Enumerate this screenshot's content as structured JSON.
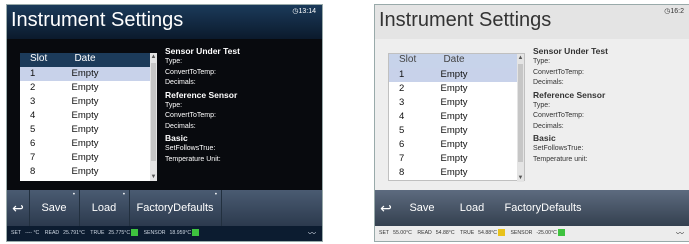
{
  "screens": {
    "dark": {
      "title": "Instrument Settings",
      "clock": "13:14",
      "list_header": {
        "slot": "Slot",
        "date": "Date"
      },
      "rows": [
        {
          "slot": "1",
          "date": "Empty"
        },
        {
          "slot": "2",
          "date": "Empty"
        },
        {
          "slot": "3",
          "date": "Empty"
        },
        {
          "slot": "4",
          "date": "Empty"
        },
        {
          "slot": "5",
          "date": "Empty"
        },
        {
          "slot": "6",
          "date": "Empty"
        },
        {
          "slot": "7",
          "date": "Empty"
        },
        {
          "slot": "8",
          "date": "Empty"
        }
      ],
      "info": {
        "sut_heading": "Sensor Under Test",
        "sut_type": "Type:",
        "sut_convert": "ConvertToTemp:",
        "sut_decimals": "Decimals:",
        "ref_heading": "Reference Sensor",
        "ref_type": "Type:",
        "ref_convert": "ConvertToTemp:",
        "ref_decimals": "Decimals:",
        "basic_heading": "Basic",
        "basic_set": "SetFollowsTrue:",
        "basic_unit": "Temperature Unit:"
      },
      "toolbar": {
        "save": "Save",
        "load": "Load",
        "factory": "FactoryDefaults"
      },
      "status": {
        "set_label": "SET",
        "set_value": "---- °C",
        "read_label": "READ",
        "read_value": "25.791°C",
        "true_label": "TRUE",
        "true_value": "25.775°C",
        "sensor_label": "SENSOR",
        "sensor_value": "18.959°C"
      },
      "colors": {
        "true_indicator": "#3ec23e",
        "sensor_indicator": "#3ec23e"
      }
    },
    "light": {
      "title": "Instrument Settings",
      "clock": "16:2",
      "list_header": {
        "slot": "Slot",
        "date": "Date"
      },
      "rows": [
        {
          "slot": "1",
          "date": "Empty"
        },
        {
          "slot": "2",
          "date": "Empty"
        },
        {
          "slot": "3",
          "date": "Empty"
        },
        {
          "slot": "4",
          "date": "Empty"
        },
        {
          "slot": "5",
          "date": "Empty"
        },
        {
          "slot": "6",
          "date": "Empty"
        },
        {
          "slot": "7",
          "date": "Empty"
        },
        {
          "slot": "8",
          "date": "Empty"
        }
      ],
      "info": {
        "sut_heading": "Sensor Under Test",
        "sut_type": "Type:",
        "sut_convert": "ConvertToTemp:",
        "sut_decimals": "Decimals:",
        "ref_heading": "Reference Sensor",
        "ref_type": "Type:",
        "ref_convert": "ConvertToTemp:",
        "ref_decimals": "Decimals:",
        "basic_heading": "Basic",
        "basic_set": "SetFollowsTrue:",
        "basic_unit": "Temperature unit:"
      },
      "toolbar": {
        "save": "Save",
        "load": "Load",
        "factory": "FactoryDefaults"
      },
      "status": {
        "set_label": "SET",
        "set_value": "55.00°C",
        "read_label": "READ",
        "read_value": "54.88°C",
        "true_label": "TRUE",
        "true_value": "54.88°C",
        "sensor_label": "SENSOR",
        "sensor_value": "-25.00°C"
      },
      "colors": {
        "true_indicator": "#e8c21a",
        "sensor_indicator": "#3ec23e"
      }
    }
  },
  "icons": {
    "back": "back-arrow-icon",
    "clock": "clock-icon",
    "wave": "signal-wave-icon"
  }
}
